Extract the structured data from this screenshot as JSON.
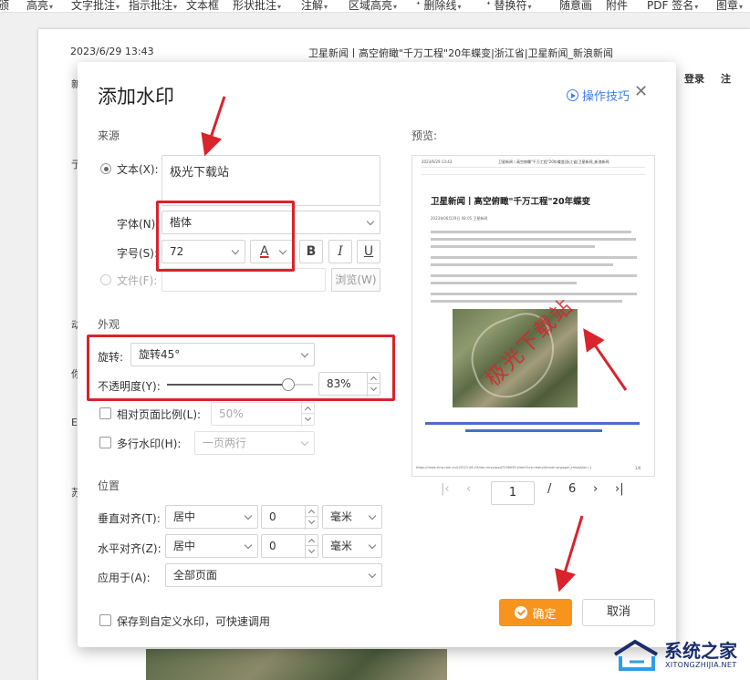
{
  "toolbar": {
    "items": [
      "颁",
      "高亮",
      "文字批注",
      "指示批注",
      "文本框",
      "形状批注",
      "注解",
      "区域高亮",
      "删除线",
      "替换符",
      "随意画",
      "附件",
      "PDF 签名",
      "图章"
    ]
  },
  "document": {
    "date": "2023/6/29 13:43",
    "title": "卫星新闻丨高空俯瞰\"千万工程\"20年蝶变|浙江省|卫星新闻_新浪新闻",
    "login": "登录",
    "note": "注",
    "edge_chars": [
      "新",
      "亍",
      "动",
      "你",
      "E",
      "苏"
    ]
  },
  "dialog": {
    "title": "添加水印",
    "tips": "操作技巧",
    "source": {
      "section": "来源",
      "text_label": "文本(X):",
      "text_value": "极光下载站",
      "font_label": "字体(N):",
      "font_value": "楷体",
      "size_label": "字号(S):",
      "size_value": "72",
      "color_glyph": "A",
      "bold_glyph": "B",
      "italic_glyph": "I",
      "underline_glyph": "U",
      "file_label": "文件(F):",
      "browse": "浏览(W)"
    },
    "appearance": {
      "section": "外观",
      "rotate_label": "旋转:",
      "rotate_value": "旋转45°",
      "opacity_label": "不透明度(Y):",
      "opacity_value": "83%",
      "opacity": 0.83,
      "relative_label": "相对页面比例(L):",
      "relative_value": "50%",
      "multiline_label": "多行水印(H):",
      "multiline_value": "一页两行"
    },
    "position": {
      "section": "位置",
      "vertical_label": "垂直对齐(T):",
      "vertical_value": "居中",
      "vertical_offset": "0",
      "vertical_unit": "毫米",
      "horizontal_label": "水平对齐(Z):",
      "horizontal_value": "居中",
      "horizontal_offset": "0",
      "horizontal_unit": "毫米",
      "apply_label": "应用于(A):",
      "apply_value": "全部页面"
    },
    "save_label": "保存到自定义水印，可快速调用",
    "preview": {
      "label": "预览:",
      "page_date": "2023/6/29 13:43",
      "page_header": "卫星新闻丨高空俯瞰\"千万工程\"20年蝶变|浙江省|卫星新闻_新浪新闻",
      "page_title": "卫星新闻丨高空俯瞰\"千万工程\"20年蝶变",
      "page_meta": "2023年06月29日 08:05  卫星新闻",
      "footer": "https://news.sina.com.cn/c/2023-06-29/doc-imyyqsxd7236055.shtml?cre=tianyi&mod=pcpager_china&loc=1",
      "page_number": "1/6",
      "watermark_text": "极光下载站",
      "watermark_color": "#d9232d",
      "current_page": "1",
      "separator": "/",
      "total_pages": "6"
    },
    "ok": "确定",
    "cancel": "取消"
  },
  "logo": {
    "text": "系统之家",
    "sub": "XITONGZHIJIA.NET",
    "color": "#1c2d6b"
  },
  "colors": {
    "accent_blue": "#3d7ff0",
    "ok_orange": "#f7941d",
    "annotation_red": "#d9232d"
  }
}
